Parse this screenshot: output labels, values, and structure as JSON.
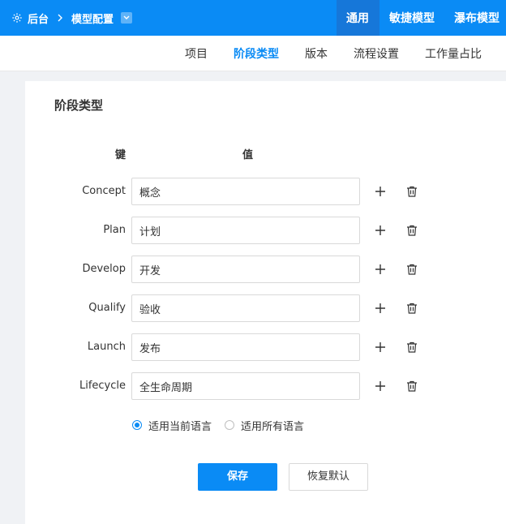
{
  "topbar": {
    "crumbs": [
      "后台",
      "模型配置"
    ],
    "tabs": [
      {
        "label": "通用",
        "active": true
      },
      {
        "label": "敏捷模型",
        "active": false
      },
      {
        "label": "瀑布模型",
        "active": false
      }
    ]
  },
  "subnav": {
    "items": [
      {
        "label": "项目",
        "active": false
      },
      {
        "label": "阶段类型",
        "active": true
      },
      {
        "label": "版本",
        "active": false
      },
      {
        "label": "流程设置",
        "active": false
      },
      {
        "label": "工作量占比",
        "active": false
      }
    ]
  },
  "card": {
    "title": "阶段类型",
    "col_key": "键",
    "col_value": "值",
    "rows": [
      {
        "key": "Concept",
        "value": "概念"
      },
      {
        "key": "Plan",
        "value": "计划"
      },
      {
        "key": "Develop",
        "value": "开发"
      },
      {
        "key": "Qualify",
        "value": "验收"
      },
      {
        "key": "Launch",
        "value": "发布"
      },
      {
        "key": "Lifecycle",
        "value": "全生命周期"
      }
    ],
    "radio_current": "适用当前语言",
    "radio_all": "适用所有语言",
    "save_label": "保存",
    "reset_label": "恢复默认"
  },
  "colors": {
    "primary": "#0a8bf5",
    "active_tab": "#1677d9"
  },
  "icons": [
    "gear-icon",
    "chevron-right-icon",
    "chevron-down-icon",
    "plus-icon",
    "trash-icon"
  ]
}
